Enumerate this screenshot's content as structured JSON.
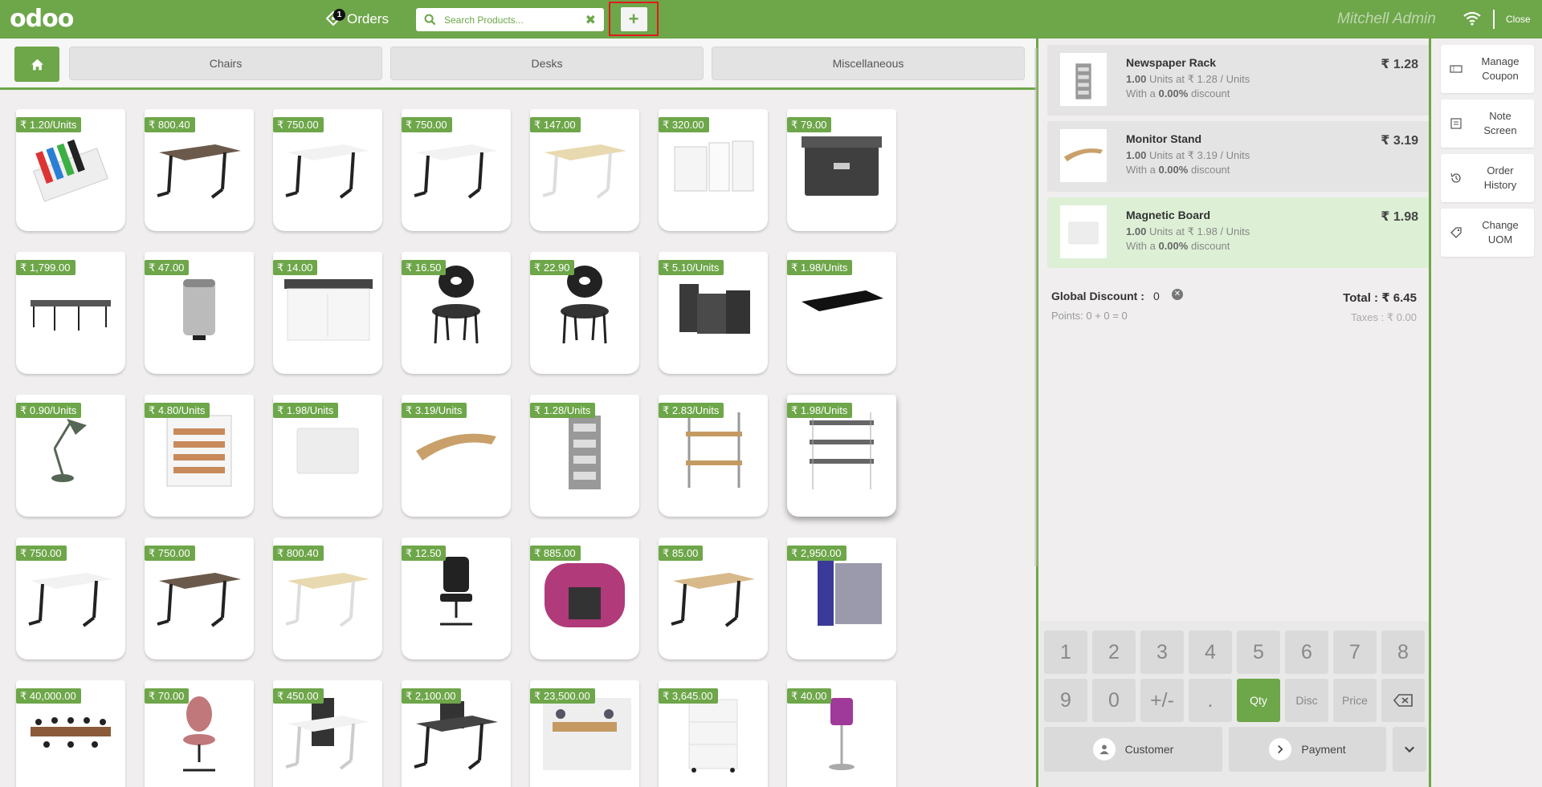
{
  "topbar": {
    "logo": "odoo",
    "orders_label": "Orders",
    "orders_badge": "1",
    "search_placeholder": "Search Products...",
    "add_label": "+",
    "user": "Mitchell Admin",
    "close_label": "Close"
  },
  "categories": [
    "Chairs",
    "Desks",
    "Miscellaneous"
  ],
  "products": [
    {
      "price": "₹ 1.20/Units",
      "img": "markers"
    },
    {
      "price": "₹ 800.40",
      "img": "desk-dark"
    },
    {
      "price": "₹ 750.00",
      "img": "desk-white"
    },
    {
      "price": "₹ 750.00",
      "img": "desk-white"
    },
    {
      "price": "₹ 147.00",
      "img": "desk-light"
    },
    {
      "price": "₹ 320.00",
      "img": "cabinet-open"
    },
    {
      "price": "₹ 79.00",
      "img": "box-dark"
    },
    {
      "price": "₹ 1,799.00",
      "img": "desk-cluster"
    },
    {
      "price": "₹ 47.00",
      "img": "bin"
    },
    {
      "price": "₹ 14.00",
      "img": "drawer-white"
    },
    {
      "price": "₹ 16.50",
      "img": "chair-black"
    },
    {
      "price": "₹ 22.90",
      "img": "chair-black"
    },
    {
      "price": "₹ 5.10/Units",
      "img": "organizer"
    },
    {
      "price": "₹ 1.98/Units",
      "img": "pad-black"
    },
    {
      "price": "₹ 0.90/Units",
      "img": "lamp-desk"
    },
    {
      "price": "₹ 4.80/Units",
      "img": "letter-tray"
    },
    {
      "price": "₹ 1.98/Units",
      "img": "board-white"
    },
    {
      "price": "₹ 3.19/Units",
      "img": "monitor-stand"
    },
    {
      "price": "₹ 1.28/Units",
      "img": "newspaper-rack"
    },
    {
      "price": "₹ 2.83/Units",
      "img": "wall-shelf"
    },
    {
      "price": "₹ 1.98/Units",
      "img": "shelf-rack"
    },
    {
      "price": "₹ 750.00",
      "img": "desk-white"
    },
    {
      "price": "₹ 750.00",
      "img": "desk-dark"
    },
    {
      "price": "₹ 800.40",
      "img": "desk-light"
    },
    {
      "price": "₹ 12.50",
      "img": "office-chair"
    },
    {
      "price": "₹ 885.00",
      "img": "pod-pink"
    },
    {
      "price": "₹ 85.00",
      "img": "desk-corner"
    },
    {
      "price": "₹ 2,950.00",
      "img": "screens"
    },
    {
      "price": "₹ 40,000.00",
      "img": "conference"
    },
    {
      "price": "₹ 70.00",
      "img": "chair-pink"
    },
    {
      "price": "₹ 450.00",
      "img": "desk-screens"
    },
    {
      "price": "₹ 2,100.00",
      "img": "desk-double"
    },
    {
      "price": "₹ 23,500.00",
      "img": "workstation"
    },
    {
      "price": "₹ 3,645.00",
      "img": "drawer-unit"
    },
    {
      "price": "₹ 40.00",
      "img": "lamp-pink"
    }
  ],
  "orderlines": [
    {
      "name": "Newspaper Rack",
      "qty": "1.00",
      "unit_text": "Units at ₹ 1.28 / Units",
      "disc_pre": "With a",
      "disc": "0.00%",
      "disc_post": "discount",
      "price": "₹ 1.28",
      "img": "newspaper-rack"
    },
    {
      "name": "Monitor Stand",
      "qty": "1.00",
      "unit_text": "Units at ₹ 3.19 / Units",
      "disc_pre": "With a",
      "disc": "0.00%",
      "disc_post": "discount",
      "price": "₹ 3.19",
      "img": "monitor-stand"
    },
    {
      "name": "Magnetic Board",
      "qty": "1.00",
      "unit_text": "Units at ₹ 1.98 / Units",
      "disc_pre": "With a",
      "disc": "0.00%",
      "disc_post": "discount",
      "price": "₹ 1.98",
      "img": "board-white"
    }
  ],
  "summary": {
    "global_discount_label": "Global Discount :",
    "global_discount_value": "0",
    "points": "Points: 0 + 0 = 0",
    "total": "Total : ₹ 6.45",
    "taxes": "Taxes : ₹ 0.00"
  },
  "numpad": {
    "row1": [
      "1",
      "2",
      "3",
      "4",
      "5",
      "6",
      "7",
      "8"
    ],
    "row2": [
      "9",
      "0",
      "+/-",
      ".",
      "Qty",
      "Disc",
      "Price"
    ],
    "customer": "Customer",
    "payment": "Payment"
  },
  "controls": [
    "Manage\nCoupon",
    "Note\nScreen",
    "Order\nHistory",
    "Change\nUOM"
  ],
  "colors": {
    "brand": "#6ea64a",
    "highlight": "#e01b1b"
  }
}
